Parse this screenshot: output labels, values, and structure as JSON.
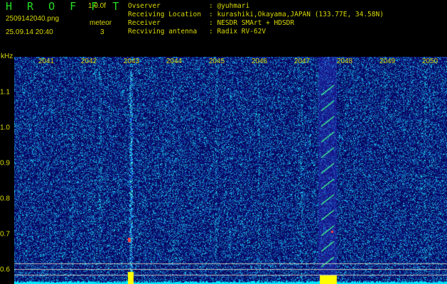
{
  "header": {
    "brand": "H R O F F T",
    "version": "1.0.0f",
    "filename": "2509142040.png",
    "meteor_label": "meteor",
    "datetime": "25.09.14 20:40",
    "meteor_count": "3"
  },
  "info": [
    {
      "label": "Ovserver",
      "value": ": @yuhmari"
    },
    {
      "label": "Receiving Location",
      "value": ": kurashiki,Okayama,JAPAN (133.77E, 34.58N)"
    },
    {
      "label": "Receiver",
      "value": ": NESDR SMArt + HDSDR"
    },
    {
      "label": "Recviving antenna",
      "value": ": Radix RV-62V"
    }
  ],
  "axis": {
    "unit": "kHz",
    "time_ticks": [
      "2041",
      "2042",
      "2043",
      "2044",
      "2045",
      "2046",
      "2047",
      "2048",
      "2049",
      "2050"
    ],
    "freq_ticks": [
      "1.1",
      "1.0",
      "0.9",
      "0.8",
      "0.7",
      "0.6"
    ]
  },
  "colors": {
    "background": "#000000",
    "spectrogram_base": "#0a0a6e",
    "text": "#d8d800",
    "brand": "#22dd22",
    "signal": "#00ffff",
    "peak": "#ffff00"
  }
}
